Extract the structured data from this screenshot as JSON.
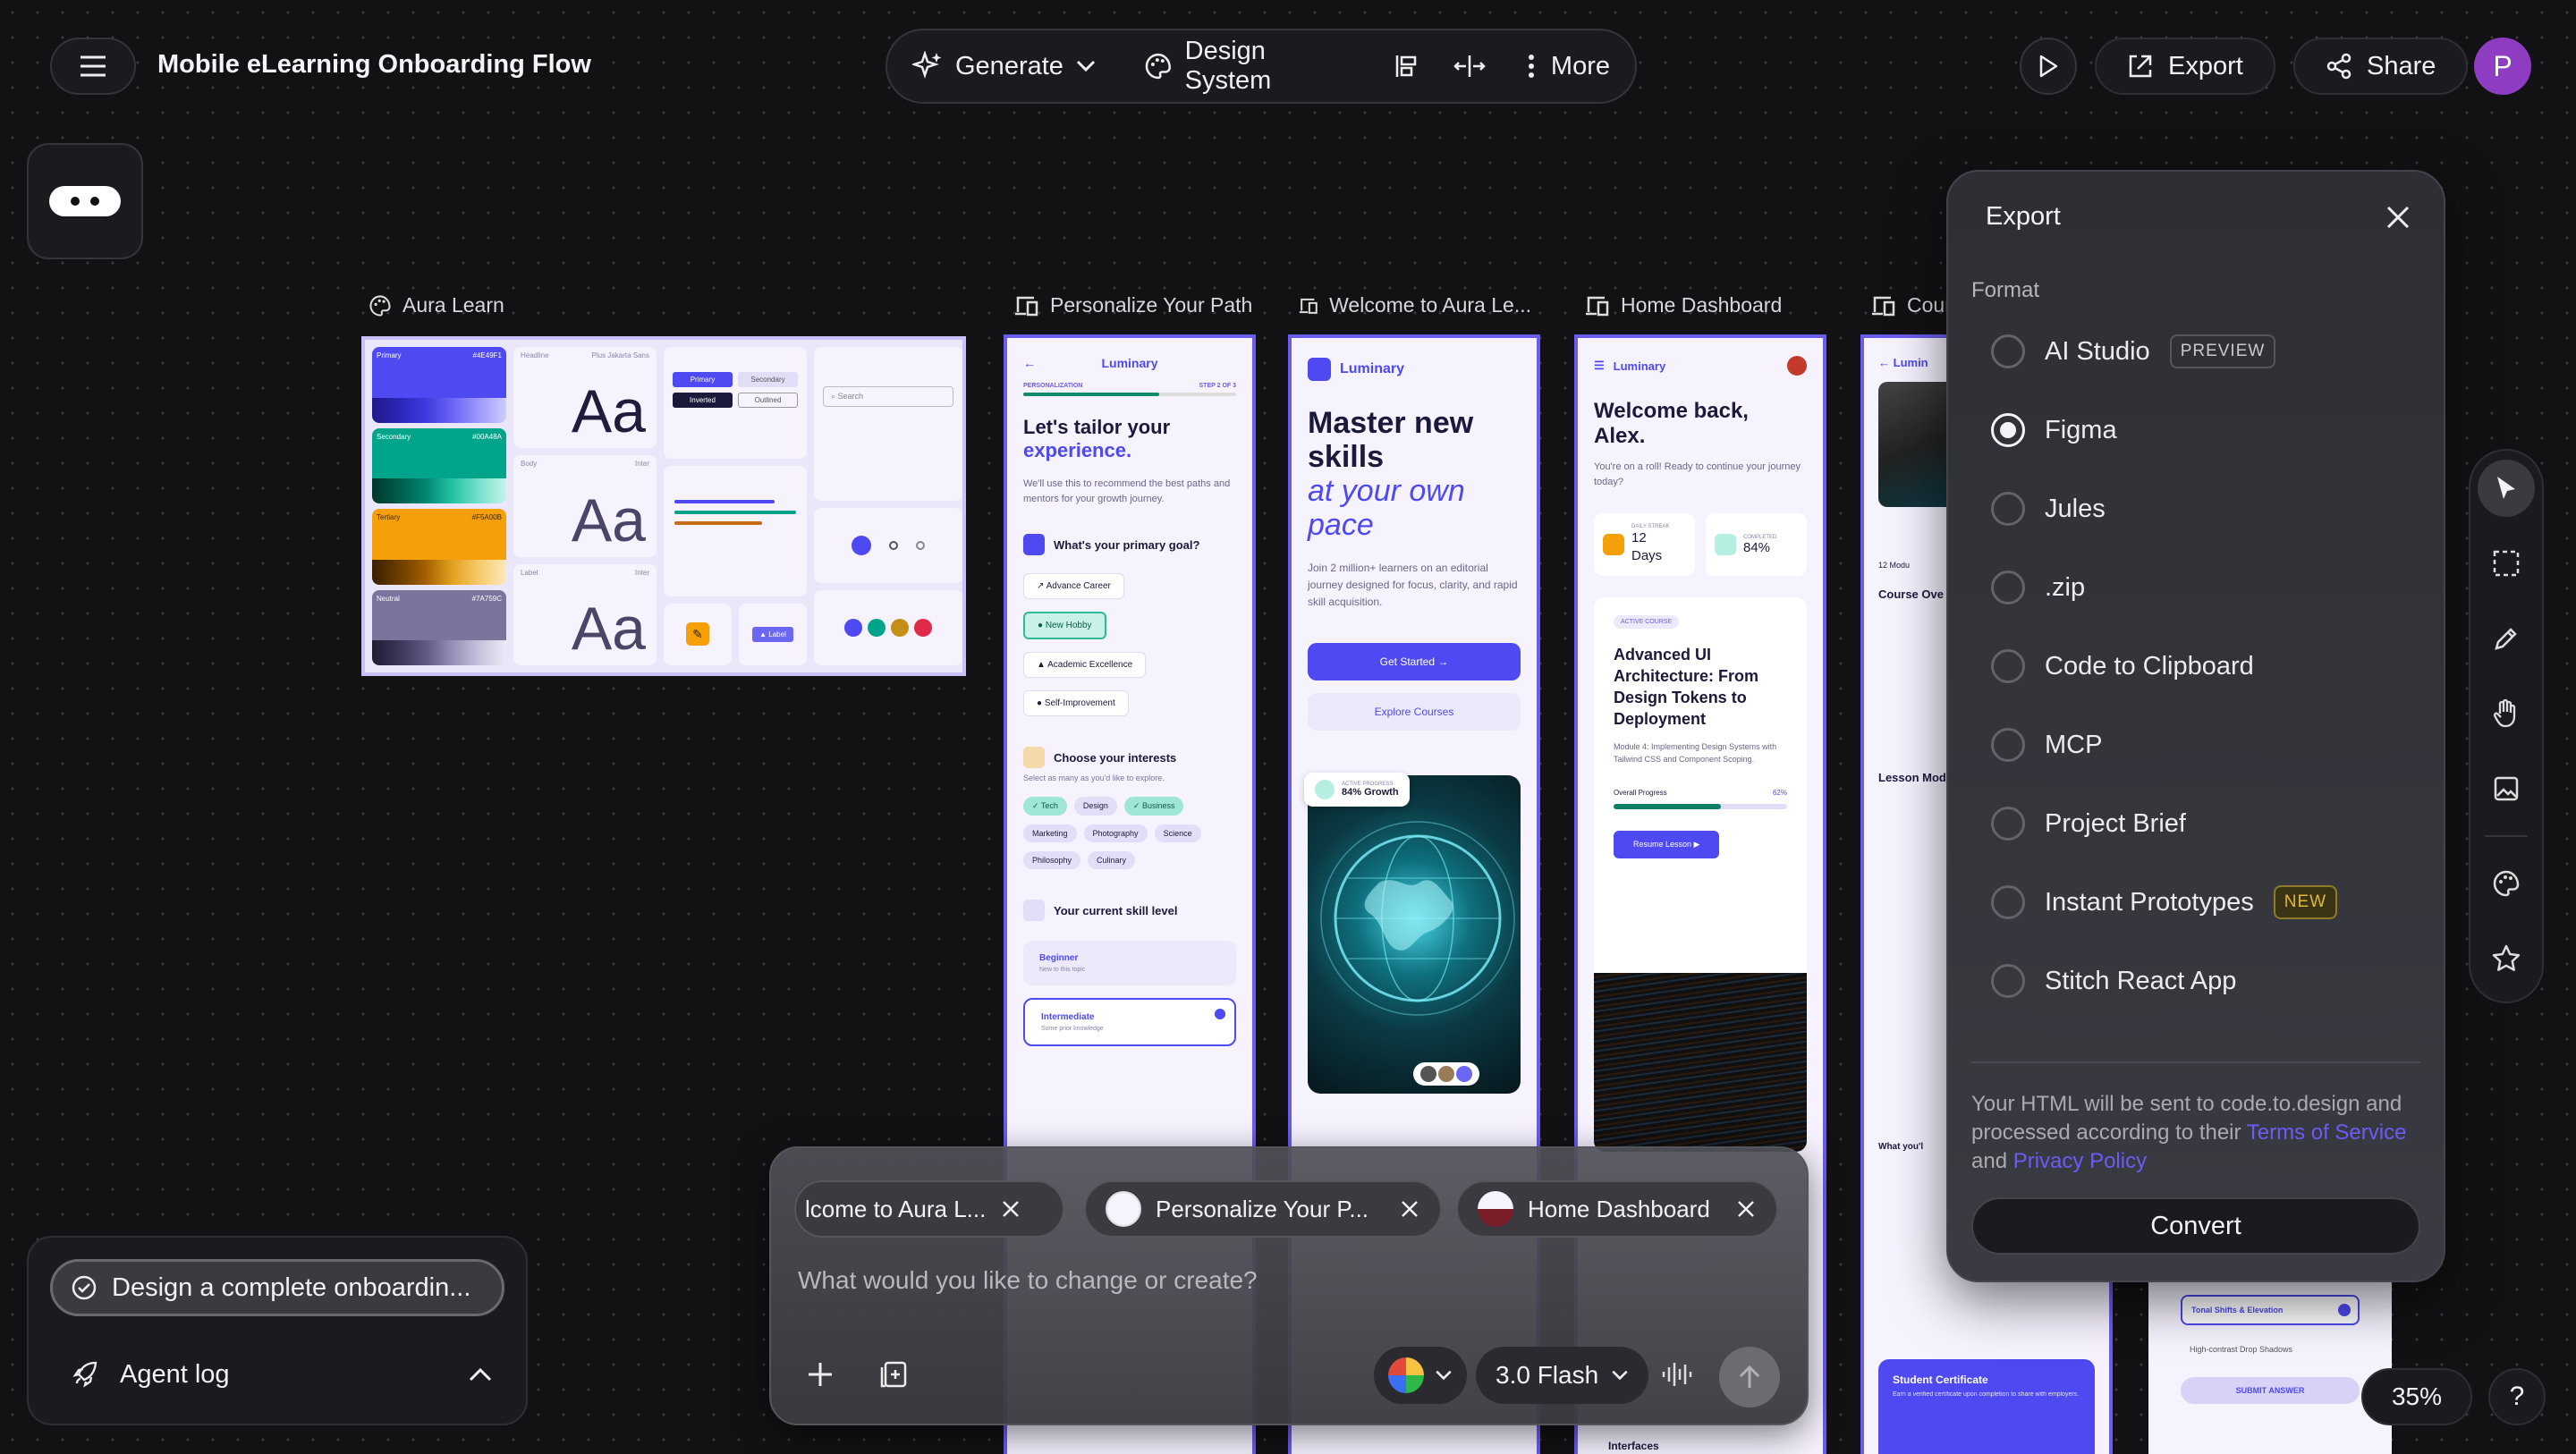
{
  "header": {
    "title": "Mobile eLearning Onboarding Flow",
    "generate_label": "Generate",
    "design_system_label": "Design System",
    "more_label": "More",
    "export_label": "Export",
    "share_label": "Share",
    "avatar_initial": "P"
  },
  "frames": [
    {
      "label": "Aura Learn",
      "icon": "palette-icon"
    },
    {
      "label": "Personalize Your Path",
      "icon": "devices-icon"
    },
    {
      "label": "Welcome to Aura Le...",
      "icon": "devices-icon"
    },
    {
      "label": "Home Dashboard",
      "icon": "devices-icon"
    },
    {
      "label": "Cour",
      "icon": "devices-icon"
    }
  ],
  "design_system": {
    "swatches": [
      {
        "name": "Primary",
        "hex": "#4E49F1",
        "color": "#4e49f1"
      },
      {
        "name": "Secondary",
        "hex": "#00A48A",
        "color": "#00a48a"
      },
      {
        "name": "Tertiary",
        "hex": "#F5A00B",
        "color": "#f5a00b"
      },
      {
        "name": "Neutral",
        "hex": "#7A759C",
        "color": "#7a759c"
      }
    ],
    "type_samples": [
      {
        "role": "Headline",
        "font": "Plus Jakarta Sans",
        "sample": "Aa"
      },
      {
        "role": "Body",
        "font": "Inter",
        "sample": "Aa"
      },
      {
        "role": "Label",
        "font": "Inter",
        "sample": "Aa"
      }
    ],
    "buttons": [
      "Primary",
      "Secondary",
      "Inverted",
      "Outlined"
    ],
    "search_placeholder": "Search",
    "label_chip": "Label"
  },
  "personalize": {
    "brand": "Luminary",
    "step_left": "PERSONALIZATION",
    "step_right": "STEP 2 OF 3",
    "title_1": "Let's tailor your",
    "title_2": "experience.",
    "body": "We'll use this to recommend the best paths and mentors for your growth journey.",
    "goal_heading": "What's your primary goal?",
    "goals": [
      "Advance Career",
      "New Hobby",
      "Academic Excellence",
      "Self-Improvement"
    ],
    "interests_heading": "Choose your interests",
    "interests_sub": "Select as many as you'd like to explore.",
    "interests": [
      "✓ Tech",
      "Design",
      "✓ Business",
      "Marketing",
      "Photography",
      "Science",
      "Philosophy",
      "Culinary"
    ],
    "skill_heading": "Your current skill level",
    "skill_1": "Beginner",
    "skill_1_sub": "New to this topic",
    "skill_2": "Intermediate",
    "skill_2_sub": "Some prior knowledge"
  },
  "welcome": {
    "brand": "Luminary",
    "title_1": "Master new",
    "title_2": "skills",
    "title_3": "at your own",
    "title_4": "pace",
    "body": "Join 2 million+ learners on an editorial journey designed for focus, clarity, and rapid skill acquisition.",
    "cta": "Get Started →",
    "secondary": "Explore Courses",
    "progress_label": "ACTIVE PROGRESS",
    "progress_value": "84% Growth"
  },
  "dashboard": {
    "brand": "Luminary",
    "greeting_1": "Welcome back,",
    "greeting_2": "Alex.",
    "sub": "You're on a roll! Ready to continue your journey today?",
    "streak_label": "DAILY STREAK",
    "streak_value": "12 Days",
    "completed_label": "COMPLETED",
    "completed_value": "84%",
    "active_badge": "ACTIVE COURSE",
    "course_title": "Advanced UI Architecture: From Design Tokens to Deployment",
    "module": "Module 4: Implementing Design Systems with Tailwind CSS and Component Scoping.",
    "overall_label": "Overall Progress",
    "overall_value": "62%",
    "overall_fraction": 0.62,
    "resume": "Resume Lesson ▶",
    "interfaces": "Interfaces"
  },
  "course": {
    "brand": "Lumin",
    "overview": "Course Ove",
    "lessons_heading": "Lesson Mod",
    "certificate_title": "Student Certificate",
    "certificate_body": "Earn a verified certificate upon completion to share with employers.",
    "modules_count": "12 Modu",
    "what_you": "What you'l"
  },
  "quiz": {
    "option_1": "Tonal Shifts & Elevation",
    "option_2": "High-contrast Drop Shadows",
    "submit": "SUBMIT ANSWER"
  },
  "export_panel": {
    "title": "Export",
    "format_label": "Format",
    "options": [
      {
        "label": "AI Studio",
        "badge": "PREVIEW",
        "selected": false
      },
      {
        "label": "Figma",
        "badge": "",
        "selected": true
      },
      {
        "label": "Jules",
        "badge": "",
        "selected": false
      },
      {
        "label": ".zip",
        "badge": "",
        "selected": false
      },
      {
        "label": "Code to Clipboard",
        "badge": "",
        "selected": false
      },
      {
        "label": "MCP",
        "badge": "",
        "selected": false
      },
      {
        "label": "Project Brief",
        "badge": "",
        "selected": false
      },
      {
        "label": "Instant Prototypes",
        "badge": "NEW",
        "selected": false
      },
      {
        "label": "Stitch React App",
        "badge": "",
        "selected": false
      }
    ],
    "disclaimer_1": "Your HTML will be sent to code.to.design and processed according to their ",
    "terms_link": "Terms of Service",
    "disclaimer_and": " and ",
    "privacy_link": "Privacy Policy",
    "convert_label": "Convert"
  },
  "prompt_box": {
    "chips": [
      "lcome to Aura L...",
      "Personalize Your P...",
      "Home Dashboard"
    ],
    "placeholder": "What would you like to change or create?",
    "model_label": "3.0 Flash"
  },
  "agent": {
    "task_label": "Design a complete onboardin...",
    "log_label": "Agent log"
  },
  "zoom_label": "35%",
  "help_label": "?"
}
